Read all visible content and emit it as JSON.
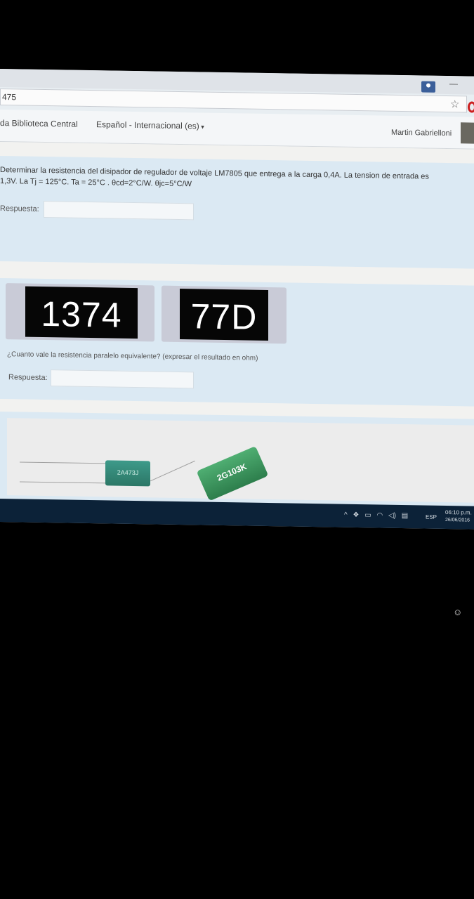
{
  "browser": {
    "address": "475",
    "minimize_glyph": "—",
    "star_icon": "☆"
  },
  "navbar": {
    "library_link": "da Biblioteca Central",
    "language_menu": "Español - Internacional (es)",
    "user_name": "Martin Gabrielloni"
  },
  "question1": {
    "text_line1": "Determinar la resistencia del disipador de regulador de voltaje LM7805 que entrega a la carga 0,4A. La tension de entrada es",
    "text_line2": "1,3V. La Tj = 125°C. Ta = 25°C . θcd=2°C/W. θjc=5°C/W",
    "answer_label": "Respuesta:",
    "answer_value": ""
  },
  "question2": {
    "resistor1_code": "1374",
    "resistor2_code": "77D",
    "prompt": "¿Cuanto vale la resistencia paralelo equivalente? (expresar el resultado en ohm)",
    "answer_label": "Respuesta:",
    "answer_value": ""
  },
  "question3": {
    "capacitor1_code": "2A473J",
    "capacitor2_code": "2G103K"
  },
  "taskbar": {
    "tray_icons": [
      "chevron-up-icon",
      "dropbox-icon",
      "battery-icon",
      "wifi-icon",
      "volume-icon",
      "notification-icon"
    ],
    "tray_glyphs": [
      "^",
      "❖",
      "▭",
      "◠",
      "◁)",
      "▤"
    ],
    "language": "ESP",
    "time": "06:10 p.m.",
    "date": "26/06/2016"
  },
  "phone_overlay_glyph": "☺"
}
